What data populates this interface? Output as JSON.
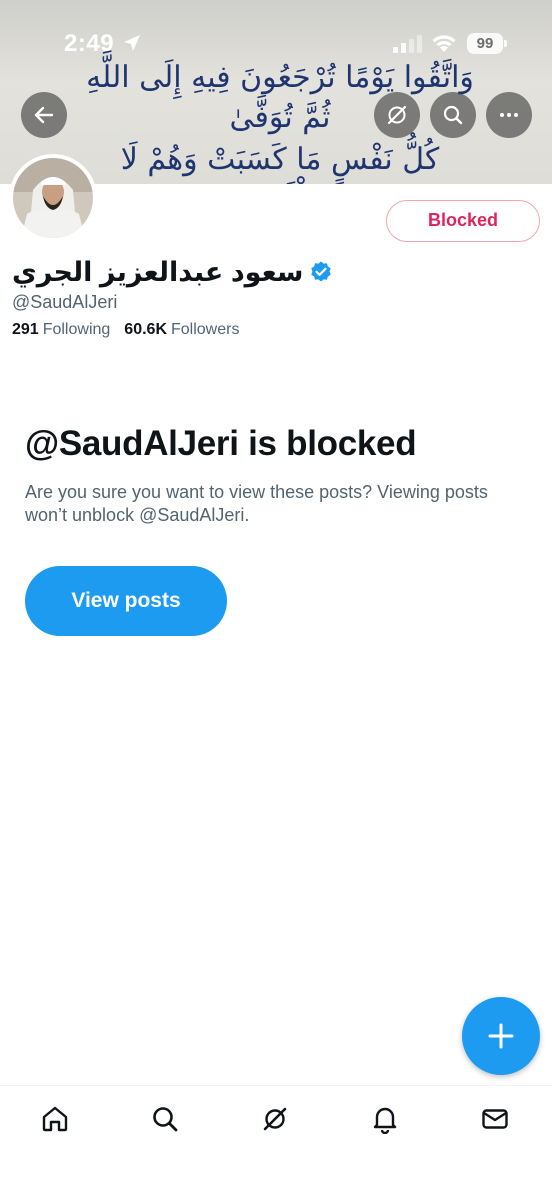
{
  "status_bar": {
    "time": "2:49",
    "battery": "99"
  },
  "banner": {
    "line1": "وَاتَّقُوا يَوْمًا تُرْجَعُونَ فِيهِ إِلَى اللَّهِ ثُمَّ تُوَفَّىٰ",
    "line2": "كُلُّ نَفْسٍ مَا كَسَبَتْ وَهُمْ لَا يُظْلَمُونَ"
  },
  "profile": {
    "display_name": "سعود عبدالعزيز الجري",
    "handle": "@SaudAlJeri",
    "following_count": "291",
    "following_label": "Following",
    "followers_count": "60.6K",
    "followers_label": "Followers",
    "blocked_button": "Blocked"
  },
  "blocked_notice": {
    "title": "@SaudAlJeri is blocked",
    "description": "Are you sure you want to view these posts? Viewing posts won’t unblock @SaudAlJeri.",
    "button": "View posts"
  },
  "colors": {
    "accent": "#1d9bf0",
    "blocked_red": "#e0245e",
    "verified": "#1d9bf0"
  },
  "icons": [
    "back-arrow-icon",
    "grok-icon",
    "search-icon",
    "more-icon",
    "verified-icon",
    "plus-icon",
    "home-icon",
    "explore-icon",
    "notifications-icon",
    "messages-icon"
  ]
}
